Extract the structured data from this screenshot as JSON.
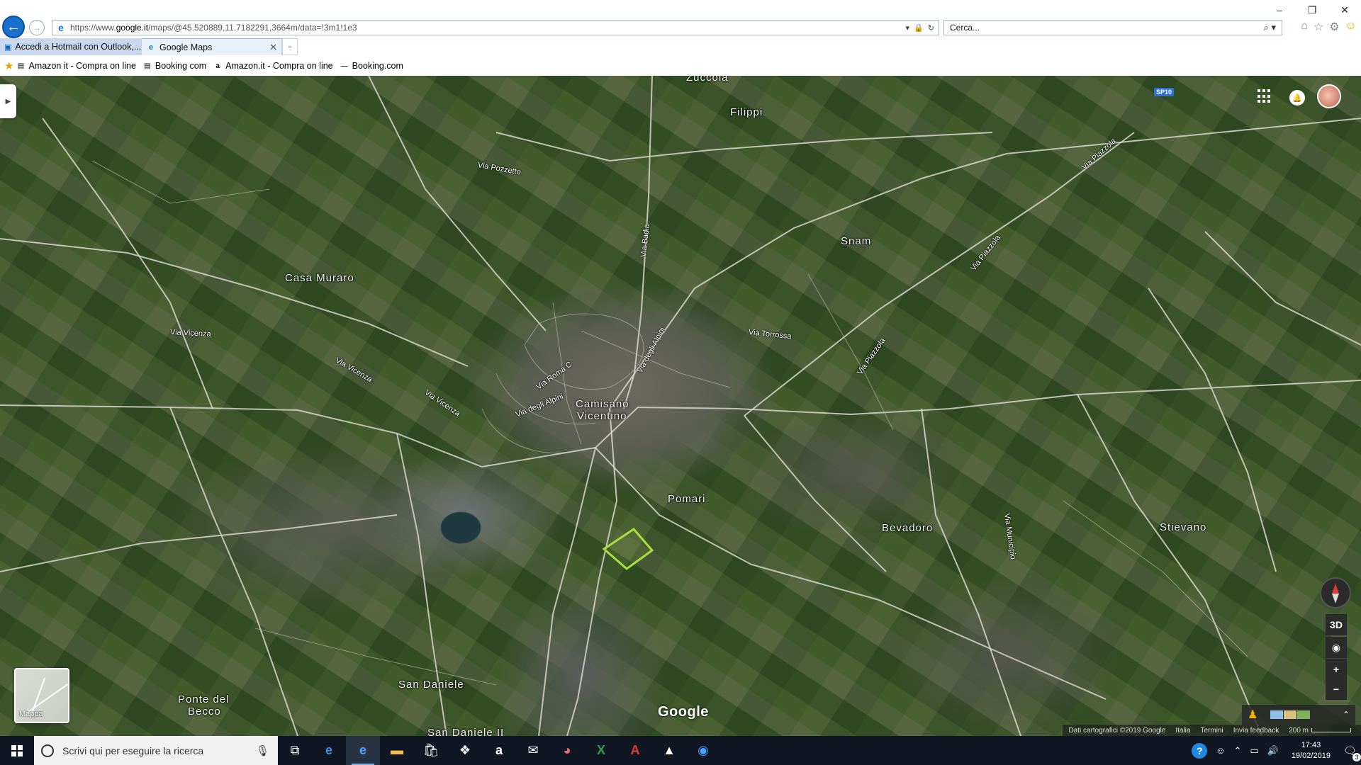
{
  "browser": {
    "url_prefix": "https://www.",
    "url_domain": "google.it",
    "url_rest": "/maps/@45.520889,11.7182291,3664m/data=!3m1!1e3",
    "search_placeholder": "Cerca...",
    "window_controls": [
      "–",
      "❐",
      "✕"
    ],
    "tabs": [
      {
        "label": "Accedi a Hotmail con Outlook,...",
        "active": false
      },
      {
        "label": "Google Maps",
        "active": true
      }
    ],
    "favorites": [
      {
        "label": "Amazon it - Compra on line",
        "icon": "page-icon"
      },
      {
        "label": "Booking com",
        "icon": "page-icon"
      },
      {
        "label": "Amazon.it - Compra on line",
        "icon": "amazon-icon"
      },
      {
        "label": "Booking.com",
        "icon": "booking-icon"
      }
    ]
  },
  "map": {
    "places": [
      {
        "name": "Zuccola"
      },
      {
        "name": "Filippi"
      },
      {
        "name": "Snam"
      },
      {
        "name": "Casa Muraro"
      },
      {
        "name": "Camisano"
      },
      {
        "name": "Vicentino"
      },
      {
        "name": "Pomari"
      },
      {
        "name": "Bevadoro"
      },
      {
        "name": "Stievano"
      },
      {
        "name": "San Daniele"
      },
      {
        "name": "Ponte del"
      },
      {
        "name": "Becco"
      },
      {
        "name": "San Daniele II"
      }
    ],
    "roads": [
      {
        "name": "Via Pozzetto"
      },
      {
        "name": "Via Badia"
      },
      {
        "name": "Via Piazzola"
      },
      {
        "name": "Via Piazzola"
      },
      {
        "name": "Via Piazzola"
      },
      {
        "name": "Via Vicenza"
      },
      {
        "name": "Via Vicenza"
      },
      {
        "name": "Via Vicenza"
      },
      {
        "name": "Via Torrossa"
      },
      {
        "name": "Via Roma C"
      },
      {
        "name": "Via degli Alpini"
      },
      {
        "name": "Via degli Alpini"
      },
      {
        "name": "Via Municipio"
      }
    ],
    "route_badge": "SP10",
    "minimap_label": "Mappa",
    "google_logo": "Google",
    "controls": {
      "three_d": "3D",
      "zoom_in": "+",
      "zoom_out": "−"
    },
    "attribution": {
      "data": "Dati cartografici ©2019 Google",
      "country": "Italia",
      "terms": "Termini",
      "feedback": "Invia feedback",
      "scale": "200 m"
    }
  },
  "taskbar": {
    "search_placeholder": "Scrivi qui per eseguire la ricerca",
    "apps": [
      {
        "name": "task-view-icon",
        "glyph": "⧉"
      },
      {
        "name": "edge-icon",
        "glyph": "e"
      },
      {
        "name": "internet-explorer-icon",
        "glyph": "e"
      },
      {
        "name": "file-explorer-icon",
        "glyph": "▬"
      },
      {
        "name": "store-icon",
        "glyph": "🛍"
      },
      {
        "name": "dropbox-icon",
        "glyph": "❖"
      },
      {
        "name": "amazon-icon",
        "glyph": "a"
      },
      {
        "name": "mail-icon",
        "glyph": "✉"
      },
      {
        "name": "paint-icon",
        "glyph": "◕"
      },
      {
        "name": "excel-icon",
        "glyph": "X"
      },
      {
        "name": "acrobat-icon",
        "glyph": "A"
      },
      {
        "name": "photos-icon",
        "glyph": "▲"
      },
      {
        "name": "messaging-icon",
        "glyph": "◉"
      }
    ],
    "time": "17:43",
    "date": "19/02/2019",
    "notification_count": "3"
  },
  "colors": {
    "parcel_outline": "#a8e03a",
    "ie_blue": "#1a6fcf",
    "taskbar": "#101723"
  }
}
